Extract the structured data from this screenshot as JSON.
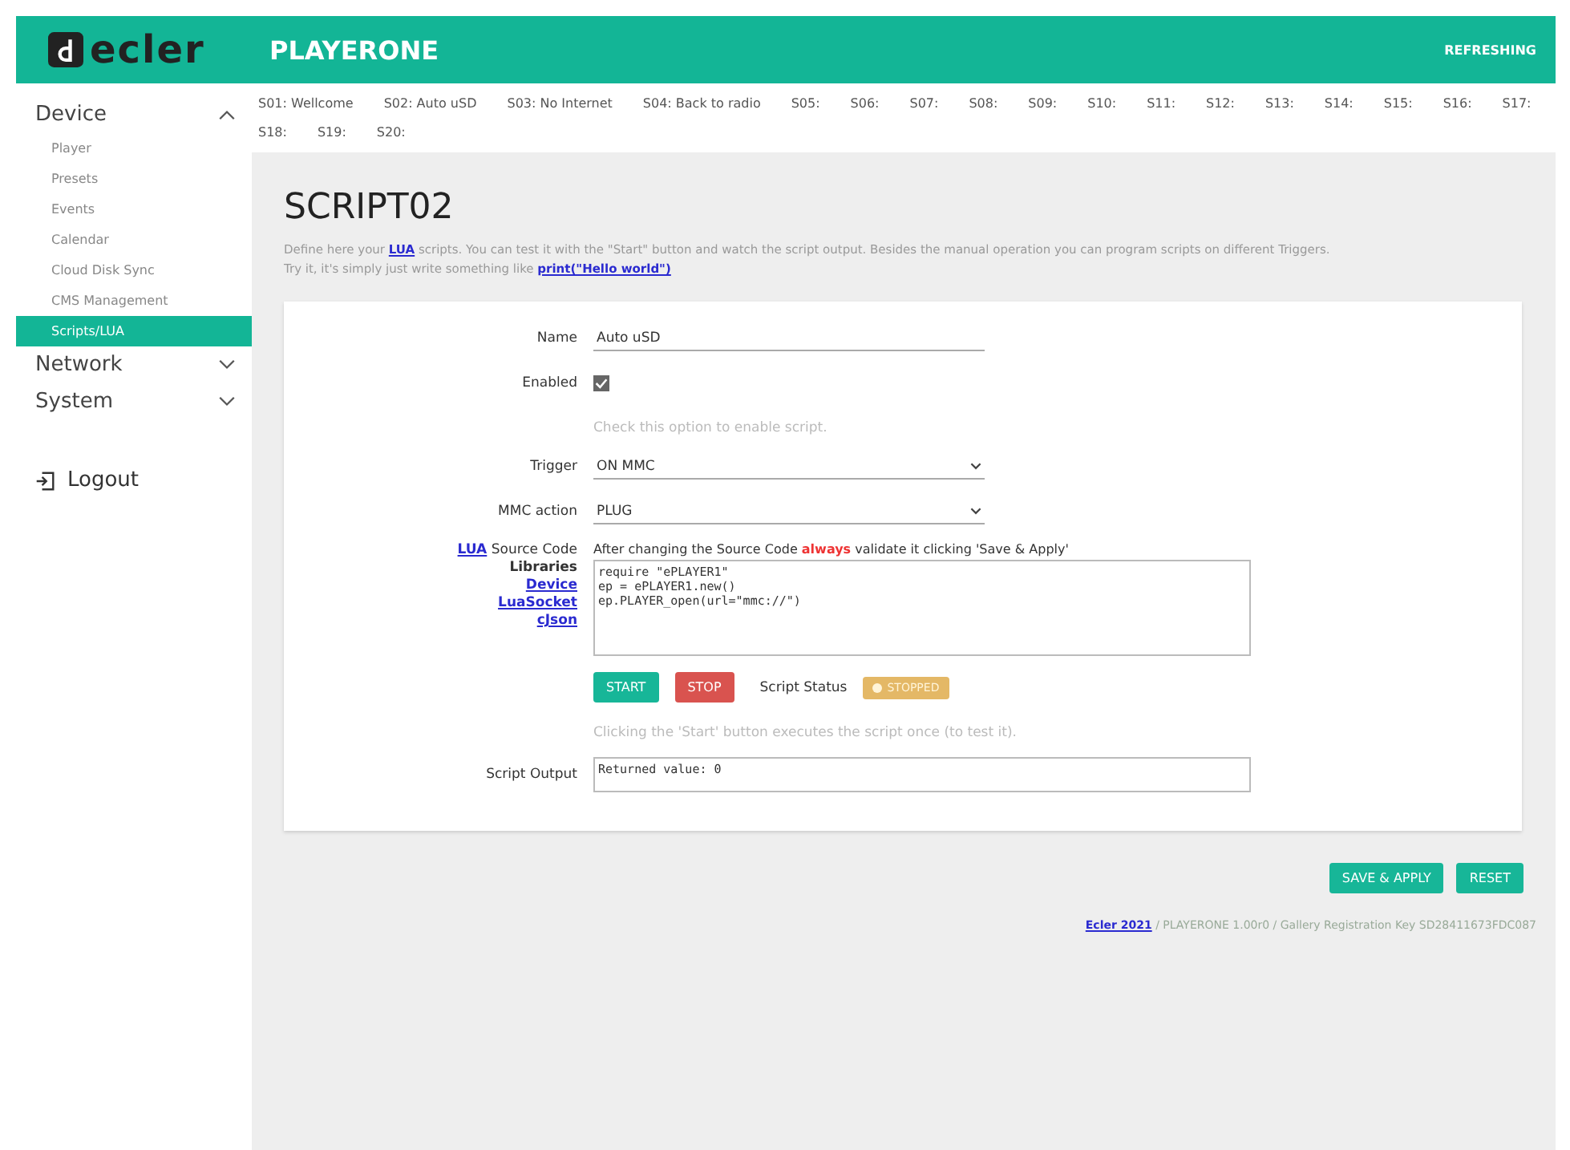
{
  "header": {
    "logo": "ecler",
    "title": "PLAYERONE",
    "status": "REFRESHING"
  },
  "sidebar": {
    "sections": [
      {
        "label": "Device",
        "expanded": true,
        "items": [
          {
            "label": "Player",
            "selected": false
          },
          {
            "label": "Presets",
            "selected": false
          },
          {
            "label": "Events",
            "selected": false
          },
          {
            "label": "Calendar",
            "selected": false
          },
          {
            "label": "Cloud Disk Sync",
            "selected": false
          },
          {
            "label": "CMS Management",
            "selected": false
          },
          {
            "label": "Scripts/LUA",
            "selected": true
          }
        ]
      },
      {
        "label": "Network",
        "expanded": false
      },
      {
        "label": "System",
        "expanded": false
      }
    ],
    "logout": "Logout"
  },
  "script_tabs": [
    "S01: Wellcome",
    "S02: Auto uSD",
    "S03: No Internet",
    "S04: Back to radio",
    "S05:",
    "S06:",
    "S07:",
    "S08:",
    "S09:",
    "S10:",
    "S11:",
    "S12:",
    "S13:",
    "S14:",
    "S15:",
    "S16:",
    "S17:",
    "S18:",
    "S19:",
    "S20:"
  ],
  "page": {
    "title": "SCRIPT02",
    "intro_1": "Define here your ",
    "intro_link": "LUA",
    "intro_2": " scripts. You can test it with the \"Start\" button and watch the script output. Besides the manual operation you can program scripts on different Triggers.",
    "intro_3": "Try it, it's simply just write something like ",
    "intro_example": "print(\"Hello world\")"
  },
  "form": {
    "name_label": "Name",
    "name_value": "Auto uSD",
    "enabled_label": "Enabled",
    "enabled": true,
    "enabled_hint": "Check this option to enable script.",
    "trigger_label": "Trigger",
    "trigger_value": "ON MMC",
    "mmc_label": "MMC action",
    "mmc_value": "PLUG",
    "source_link": "LUA",
    "source_label": " Source Code",
    "libraries_label": "Libraries",
    "libraries": [
      "Device",
      "LuaSocket",
      "cJson"
    ],
    "source_note_1": "After changing the Source Code ",
    "source_note_bold": "always",
    "source_note_2": " validate it clicking 'Save & Apply'",
    "source_code": "require \"ePLAYER1\"\nep = ePLAYER1.new()\nep.PLAYER_open(url=\"mmc://\")",
    "start": "START",
    "stop": "STOP",
    "status_label": "Script Status",
    "status_value": "STOPPED",
    "run_hint": "Clicking the 'Start' button executes the script once (to test it).",
    "output_label": "Script Output",
    "output_value": "Returned value: 0"
  },
  "actions": [
    "SAVE & APPLY",
    "RESET"
  ],
  "footer": {
    "link": "Ecler 2021",
    "text": " / PLAYERONE 1.00r0 / Gallery Registration Key SD28411673FDC087"
  }
}
